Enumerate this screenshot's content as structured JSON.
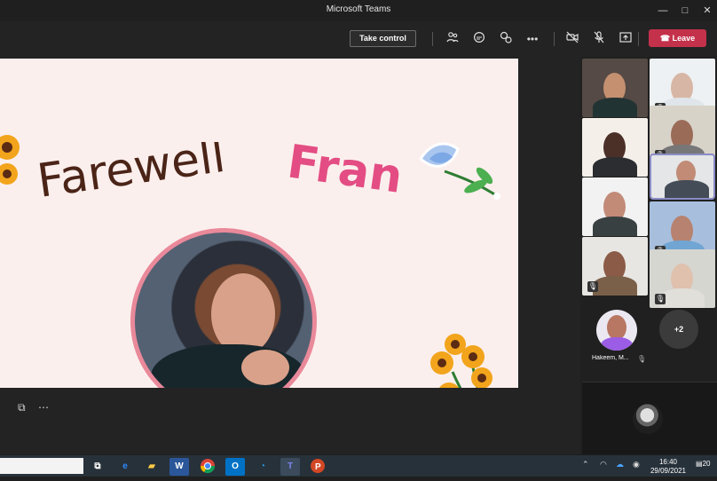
{
  "window": {
    "title": "Microsoft Teams",
    "controls": [
      "—",
      "□",
      "✕"
    ]
  },
  "toolbar": {
    "take_control": "Take control",
    "leave": "Leave",
    "icons": [
      "people-icon",
      "chat-icon",
      "reactions-icon",
      "more-icon",
      "camera-off-icon",
      "mic-off-icon",
      "share-icon"
    ]
  },
  "slide": {
    "title_part1": "Farewell",
    "title_part2": "Fran",
    "title_color1": "#4b2418",
    "title_color2": "#e34d83",
    "background": "#fbefed"
  },
  "participants": {
    "overflow": "+2",
    "featured_name": "Hakeem, M..."
  },
  "taskbar": {
    "time": "16:40",
    "date": "29/09/2021",
    "notification_count": "20"
  }
}
